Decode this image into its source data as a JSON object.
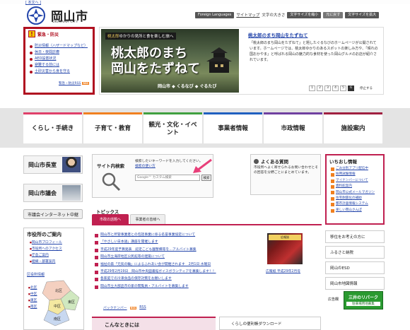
{
  "header": {
    "main_link": "[ 本文へ ]",
    "logo_title": "岡山市",
    "logo_sub": "OKAYAMA CITY",
    "foreign_languages": "Foreign Languages",
    "sitemap": "サイトマップ",
    "font_size_label": "文字の大きさ",
    "font_small": "文字サイズを縮小",
    "font_reset": "元に戻す",
    "font_large": "文字サイズを拡大"
  },
  "emergency": {
    "title": "緊急・防災",
    "items": [
      "防災情報（ハザードマップなど）",
      "休日・夜間診療",
      "AED設置状況",
      "避難する前には",
      "土砂災害から身を守る"
    ],
    "rss_label": "緊急・防災RSS",
    "rss_badge": "RSS"
  },
  "feature": {
    "caption_pre": "桃太郎",
    "caption_post": "ゆかりの見所と食を楽しむ旅へ",
    "big_line1": "桃太郎のまち",
    "big_line2": "岡山をたずねて",
    "footer": "岡山市 ◆ くるなび ◆ ぐるたび",
    "title": "桃太郎のまち岡山をたずねて",
    "desc": "「桃太郎のまち岡山をたずねて」と題したぐるなびのホームページが公開されています。ホームページでは、桃太郎ゆかりのあるスポットの楽しみ方や、「晴れの国おかやま」と呼ばれる岡山の魅力的な食材を使った岡山グルメのお店が紹介されています。",
    "pages": [
      "1",
      "2",
      "3",
      "4",
      "5",
      "6"
    ],
    "active_page": "6",
    "stop_label": "停止する"
  },
  "nav": [
    "くらし・手続き",
    "子育て・教育",
    "観光・文化・イベント",
    "事業者情報",
    "市政情報",
    "施設案内"
  ],
  "left": {
    "mayor": "岡山市長室",
    "council": "岡山市議会",
    "tv": "市議会インターネット中継",
    "office_title": "市役所のご案内",
    "office_links": [
      "岡山市プロフィール",
      "市役所へのアクセス",
      "庁舎ご案内",
      "組織・部署案内"
    ],
    "ward_label": "区役所情報",
    "ward_links": [
      "北区",
      "中区",
      "東区",
      "南区"
    ],
    "map_labels": [
      "北区",
      "中区",
      "東区",
      "南区"
    ]
  },
  "search": {
    "title": "サイト内検索",
    "hint": "検索したいキーワードを入力してください。",
    "hint_link": "検索の使い方",
    "placeholder": "Google™ カスタム検索",
    "button": "検索"
  },
  "faq": {
    "title": "よくある質問",
    "desc": "市役所へよく寄せられるお問い合わせとその回答を分野ごとにまとめています。"
  },
  "topics": {
    "title": "トピックス",
    "tab_active": "市政の話題へ",
    "tab_other": "事業者の皆様へ",
    "items": [
      "岡山市と所管事業者との包括事業に係る名誉事業協定について",
      "「やさしい日本語」講座を開催します",
      "平成29年度予算発表　認定こども園整備等を…アルバイト募集",
      "岡山市立海岸地区公民館等の建築について",
      "福祉の森「元気の輪」によるふれあい会が開催されます　2月1日 水曜日",
      "平成29年2月19日　岡山市中央図書館ボイスボランティアを募集します！！",
      "各家庭での冷凍食品の保存対策をお願いします",
      "岡山市立大部品市の家の閲覧員・アルバイトを募集します"
    ],
    "backnumber": "バックナンバー",
    "rss": "RSS"
  },
  "koho": {
    "banner": "広報誌",
    "caption": "広報紙 平成29年2月号"
  },
  "bottom": {
    "konna": "こんなときには",
    "benri": "くらしの便利帳ダウンロード"
  },
  "ichioshi": {
    "title": "いちおし情報",
    "items": [
      "ごみ分別アプリ配信中",
      "採用試験情報",
      "マイナンバーについて",
      "資料館案内",
      "岡山市公式メールマガジン",
      "住宅耐震化の補助",
      "都市計画情報システム",
      "楽しい岡山さんぽ"
    ]
  },
  "right_buttons": [
    "移住をお考えの方に",
    "ふるさと納税",
    "岡山のESD",
    "岡山市地図情報"
  ],
  "ad": {
    "label": "広告欄",
    "line1": "三井のリパーク",
    "line2": "駐車場用地募集"
  }
}
